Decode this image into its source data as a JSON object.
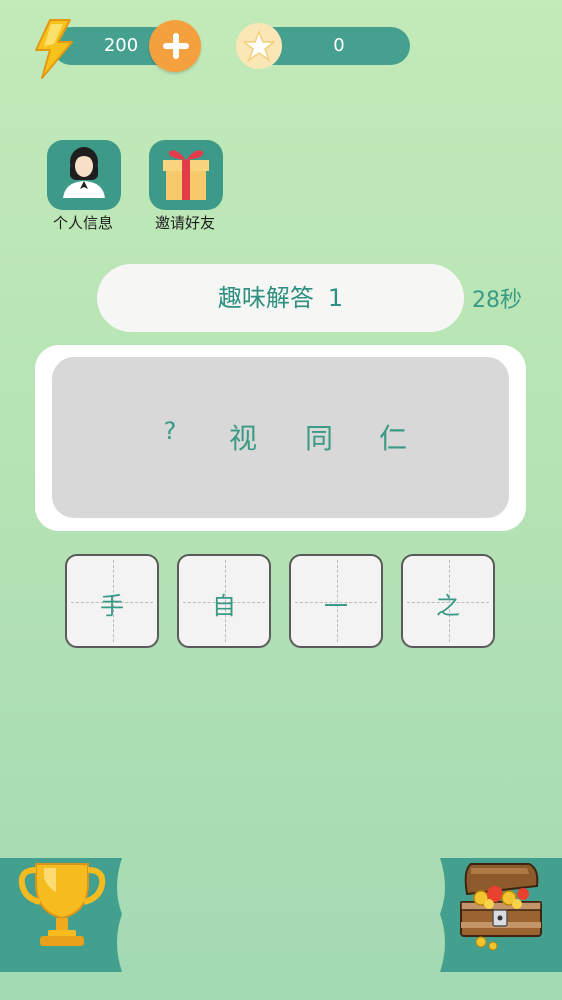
{
  "resources": {
    "energy": "200",
    "stars": "0"
  },
  "menu": {
    "profile_label": "个人信息",
    "invite_label": "邀请好友"
  },
  "puzzle": {
    "title": "趣味解答",
    "level": "1",
    "timer": "28秒",
    "question_chars": [
      "?",
      "视",
      "同",
      "仁"
    ],
    "answer_options": [
      "手",
      "自",
      "一",
      "之"
    ]
  },
  "colors": {
    "accent": "#45a090",
    "text_green": "#3a9a86",
    "orange": "#f5a03e",
    "board_gray": "#d8d8d8"
  },
  "icons": {
    "energy": "lightning-icon",
    "add": "plus-icon",
    "star": "star-icon",
    "profile": "person-icon",
    "invite": "gift-icon",
    "rank": "trophy-icon",
    "reward": "treasure-chest-icon"
  }
}
